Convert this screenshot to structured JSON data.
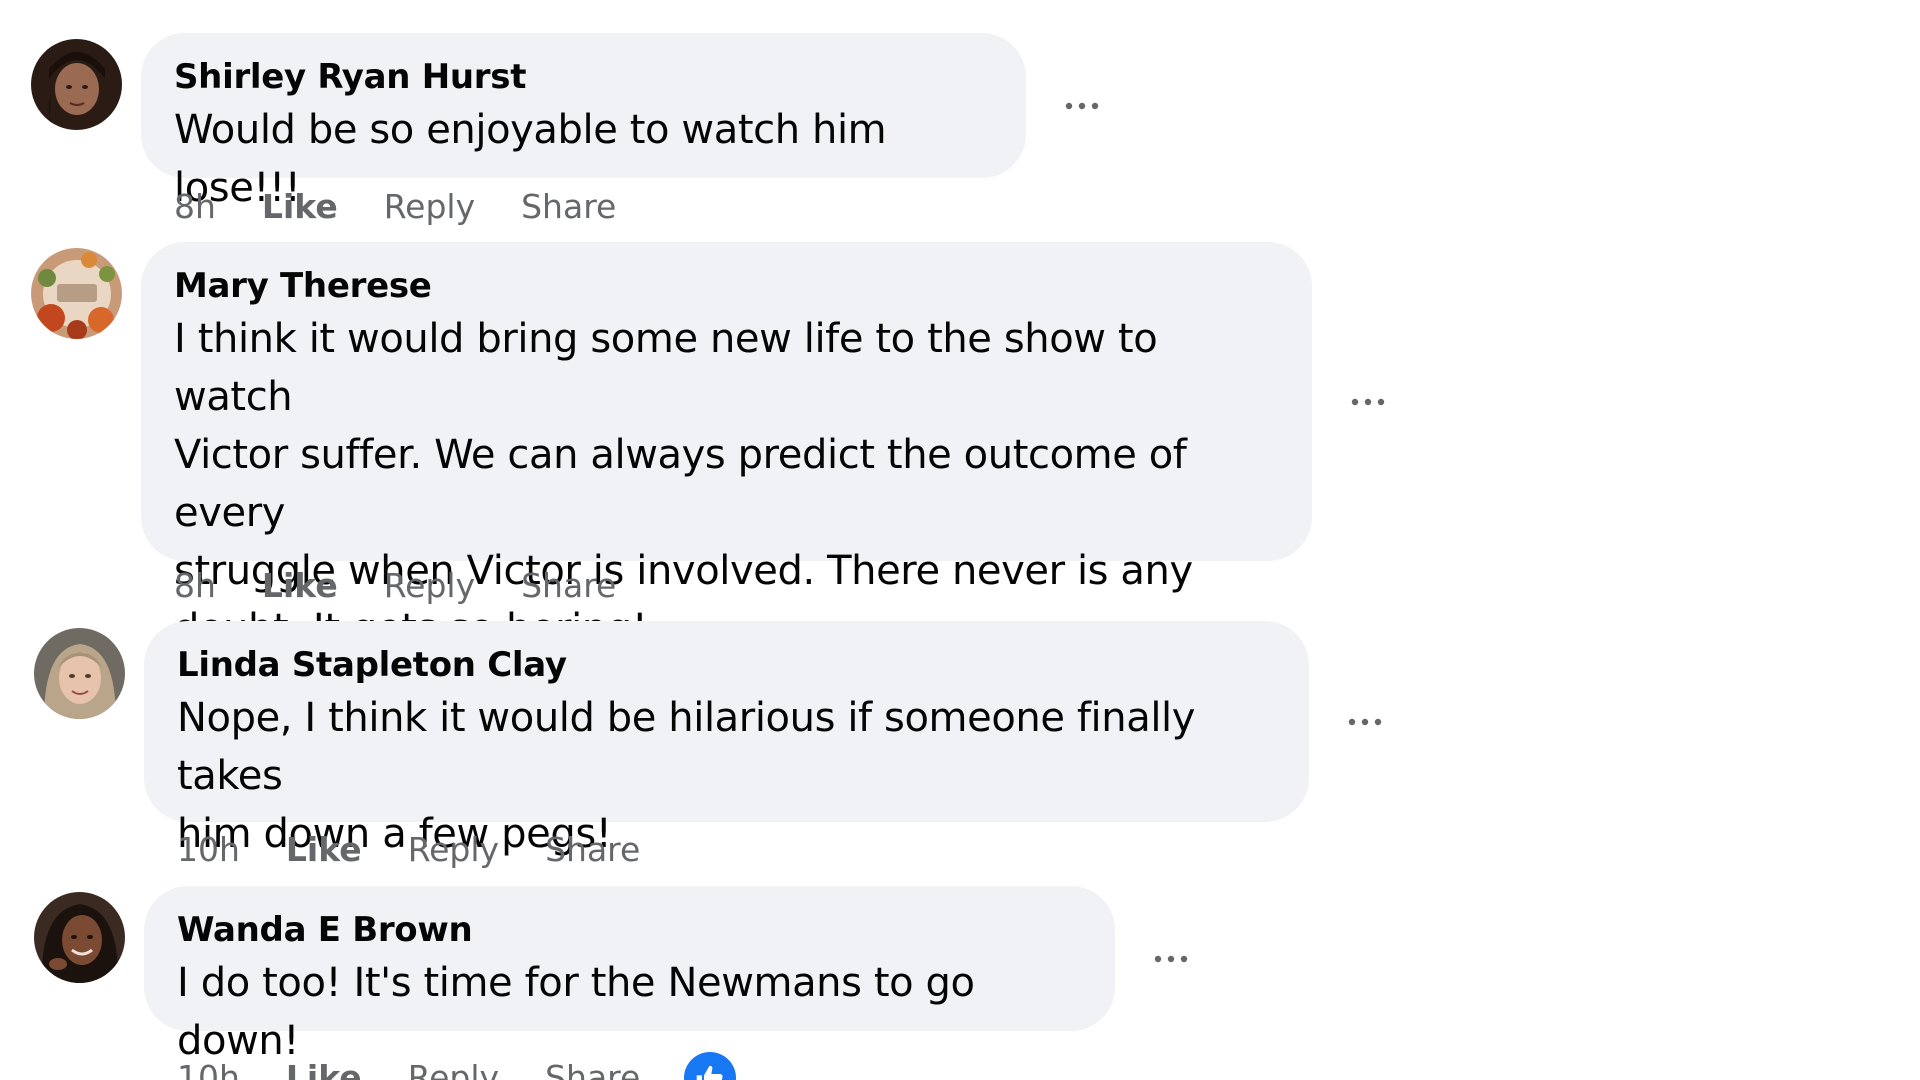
{
  "comments": [
    {
      "author": "Shirley Ryan Hurst",
      "text": "Would be so enjoyable to watch him lose!!!",
      "time": "8h",
      "like": "Like",
      "reply": "Reply",
      "share": "Share",
      "avatar": "avatar-dark-hair-woman"
    },
    {
      "author": "Mary Therese",
      "text": "I think it would bring some new life to the show to watch\nVictor suffer. We can always predict the outcome of every\nstruggle when Victor is involved. There never is any\ndoubt. It gets so boring!",
      "time": "8h",
      "like": "Like",
      "reply": "Reply",
      "share": "Share",
      "avatar": "avatar-floral-wreath"
    },
    {
      "author": "Linda Stapleton Clay",
      "text": "Nope, I think it would be hilarious if someone finally takes\nhim down a few pegs!",
      "time": "10h",
      "like": "Like",
      "reply": "Reply",
      "share": "Share",
      "avatar": "avatar-light-hair-woman"
    },
    {
      "author": "Wanda E Brown",
      "text": "I do too! It's time for the Newmans to go down!",
      "time": "10h",
      "like": "Like",
      "reply": "Reply",
      "share": "Share",
      "avatar": "avatar-smiling-woman",
      "reaction": "like-reaction-icon"
    }
  ],
  "colors": {
    "bubble": "#f0f2f5",
    "meta": "#65676b",
    "reaction": "#1877f2"
  }
}
